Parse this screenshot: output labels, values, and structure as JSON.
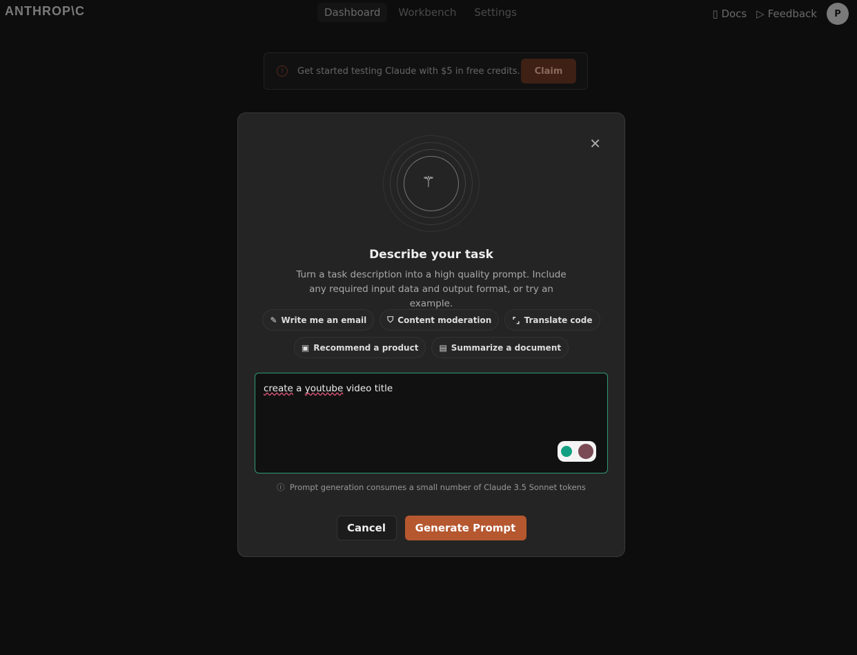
{
  "header": {
    "logo": "ANTHROP\\C",
    "nav": [
      "Dashboard",
      "Workbench",
      "Settings"
    ],
    "docs": "Docs",
    "feedback": "Feedback",
    "avatar": "P"
  },
  "banner": {
    "text": "Get started testing Claude with $5 in free credits.",
    "claim": "Claim"
  },
  "modal": {
    "title": "Describe your task",
    "description": "Turn a task description into a high quality prompt. Include any required input data and output format, or try an example.",
    "examples": [
      "Write me an email",
      "Content moderation",
      "Translate code",
      "Recommend a product",
      "Summarize a document"
    ],
    "input_value_parts": [
      "create",
      "a",
      "youtube",
      "video title"
    ],
    "note": "Prompt generation consumes a small number of Claude 3.5 Sonnet tokens",
    "cancel": "Cancel",
    "generate": "Generate Prompt"
  },
  "colors": {
    "accent": "#b5572f",
    "focus": "#2f9a78"
  }
}
